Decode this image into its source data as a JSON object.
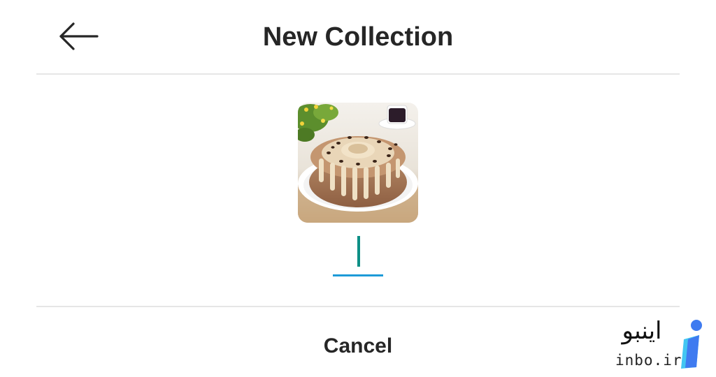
{
  "header": {
    "title": "New Collection",
    "back_icon": "arrow-left-icon"
  },
  "cover": {
    "image": "bundt-cake-photo"
  },
  "name_field": {
    "value": "",
    "placeholder": "",
    "caret_color": "#0d8f86",
    "underline_color": "#1e9bd8"
  },
  "footer": {
    "cancel_label": "Cancel"
  },
  "watermark": {
    "text_fa": "اینبو",
    "text_en": "inbo.ir",
    "logo_colors": [
      "#3f7bf0",
      "#42c6f2"
    ]
  }
}
